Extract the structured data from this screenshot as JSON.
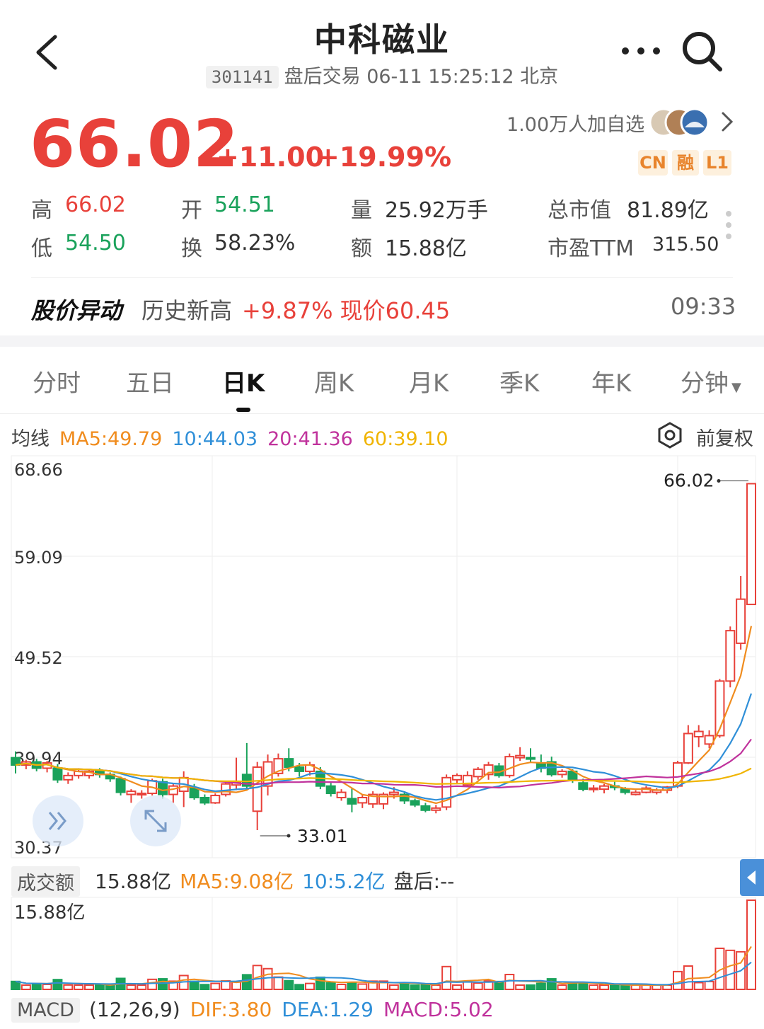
{
  "header": {
    "title": "中科磁业",
    "code": "301141",
    "status": "盘后交易 06-11 15:25:12 北京",
    "icons": [
      "back-icon",
      "more-icon",
      "search-icon"
    ]
  },
  "quote": {
    "price": "66.02",
    "change": "+11.00",
    "change_pct": "+19.99%",
    "watchers": "1.00万人加自选",
    "tags": [
      "CN",
      "融",
      "L1"
    ],
    "colors": {
      "up": "#e8413a",
      "down": "#1aa25b"
    }
  },
  "stats": {
    "high_label": "高",
    "high": "66.02",
    "open_label": "开",
    "open": "54.51",
    "volume_label": "量",
    "volume": "25.92万手",
    "mcap_label": "总市值",
    "mcap": "81.89亿",
    "low_label": "低",
    "low": "54.50",
    "turnover_label": "换",
    "turnover": "58.23%",
    "amount_label": "额",
    "amount": "15.88亿",
    "pe_label": "市盈TTM",
    "pe": "315.50"
  },
  "alert": {
    "title": "股价异动",
    "text": "历史新高",
    "change": "+9.87% 现价60.45",
    "time": "09:33"
  },
  "tabs": [
    "分时",
    "五日",
    "日K",
    "周K",
    "月K",
    "季K",
    "年K",
    "分钟"
  ],
  "active_tab": "日K",
  "ma": {
    "label": "均线",
    "ma5": "MA5:49.79",
    "ma10": "10:44.03",
    "ma20": "20:41.36",
    "ma60": "60:39.10",
    "adjust": "前复权",
    "colors": {
      "ma5": "#f08c1e",
      "ma10": "#2f8fd8",
      "ma20": "#c0329c",
      "ma60": "#f0b400"
    }
  },
  "chart_data": {
    "type": "candlestick",
    "y_ticks": [
      "68.66",
      "59.09",
      "49.52",
      "39.94",
      "30.37"
    ],
    "ylim": [
      30.37,
      68.66
    ],
    "max_label": "66.02",
    "min_label": "33.01",
    "candles": [
      [
        39.9,
        40.5,
        38.4,
        39.2
      ],
      [
        39.2,
        39.7,
        38.8,
        39.5
      ],
      [
        39.5,
        39.8,
        38.6,
        38.9
      ],
      [
        38.9,
        39.6,
        38.5,
        39.4
      ],
      [
        38.9,
        39.3,
        37.5,
        37.8
      ],
      [
        37.8,
        38.5,
        37.4,
        38.2
      ],
      [
        38.2,
        38.9,
        37.9,
        38.6
      ],
      [
        38.2,
        38.8,
        37.9,
        38.6
      ],
      [
        38.6,
        38.9,
        38.0,
        38.3
      ],
      [
        38.3,
        38.5,
        37.6,
        37.9
      ],
      [
        37.9,
        38.1,
        36.3,
        36.6
      ],
      [
        36.4,
        36.9,
        35.6,
        36.7
      ],
      [
        36.4,
        36.8,
        36.0,
        36.5
      ],
      [
        36.5,
        37.9,
        36.3,
        37.7
      ],
      [
        37.6,
        37.9,
        36.0,
        36.4
      ],
      [
        36.4,
        37.5,
        35.6,
        37.2
      ],
      [
        36.7,
        38.6,
        35.2,
        38.0
      ],
      [
        37.0,
        37.4,
        35.9,
        36.1
      ],
      [
        36.1,
        36.4,
        35.4,
        35.6
      ],
      [
        35.6,
        36.5,
        35.5,
        36.3
      ],
      [
        36.4,
        37.6,
        36.2,
        37.4
      ],
      [
        37.3,
        39.9,
        36.8,
        37.6
      ],
      [
        38.3,
        41.3,
        36.8,
        37.2
      ],
      [
        34.8,
        39.5,
        33.0,
        39.0
      ],
      [
        37.2,
        40.2,
        36.3,
        39.5
      ],
      [
        38.4,
        40.3,
        38.1,
        39.8
      ],
      [
        39.8,
        40.8,
        38.6,
        39.0
      ],
      [
        39.0,
        39.4,
        38.1,
        38.6
      ],
      [
        38.6,
        39.5,
        38.2,
        39.2
      ],
      [
        38.6,
        39.0,
        36.9,
        37.2
      ],
      [
        37.2,
        37.5,
        36.2,
        36.5
      ],
      [
        36.1,
        36.9,
        35.8,
        36.6
      ],
      [
        36.0,
        37.0,
        34.7,
        35.5
      ],
      [
        35.6,
        36.4,
        35.1,
        36.1
      ],
      [
        35.5,
        36.7,
        35.1,
        36.4
      ],
      [
        35.5,
        36.6,
        35.0,
        36.4
      ],
      [
        36.4,
        37.1,
        36.0,
        36.6
      ],
      [
        36.4,
        36.7,
        35.5,
        35.8
      ],
      [
        35.8,
        36.0,
        35.2,
        35.4
      ],
      [
        35.3,
        35.6,
        34.7,
        34.9
      ],
      [
        34.9,
        35.4,
        34.6,
        35.1
      ],
      [
        35.2,
        38.3,
        34.9,
        38.0
      ],
      [
        37.8,
        38.4,
        37.5,
        38.2
      ],
      [
        37.3,
        38.6,
        37.1,
        38.2
      ],
      [
        38.1,
        39.0,
        37.8,
        38.8
      ],
      [
        38.3,
        39.5,
        37.8,
        39.2
      ],
      [
        39.1,
        39.4,
        38.0,
        38.2
      ],
      [
        38.2,
        40.3,
        38.0,
        40.0
      ],
      [
        39.9,
        40.9,
        39.6,
        40.1
      ],
      [
        39.9,
        40.8,
        39.5,
        39.8
      ],
      [
        39.4,
        40.2,
        38.5,
        38.9
      ],
      [
        39.5,
        40.0,
        38.1,
        38.3
      ],
      [
        38.3,
        38.8,
        38.0,
        38.6
      ],
      [
        38.6,
        38.8,
        37.5,
        37.8
      ],
      [
        37.5,
        37.9,
        36.7,
        36.9
      ],
      [
        36.9,
        37.3,
        36.6,
        37.0
      ],
      [
        36.9,
        37.4,
        36.5,
        37.2
      ],
      [
        37.2,
        37.6,
        36.8,
        37.1
      ],
      [
        36.9,
        37.1,
        36.4,
        36.6
      ],
      [
        36.4,
        36.8,
        36.3,
        36.6
      ],
      [
        36.6,
        37.2,
        36.5,
        37.0
      ],
      [
        36.6,
        37.0,
        36.4,
        36.8
      ],
      [
        36.8,
        37.2,
        36.5,
        37.1
      ],
      [
        37.2,
        39.6,
        37.0,
        39.4
      ],
      [
        39.4,
        43.0,
        39.3,
        42.2
      ],
      [
        41.9,
        43.0,
        40.9,
        42.4
      ],
      [
        41.2,
        42.5,
        40.8,
        42.0
      ],
      [
        42.0,
        47.4,
        41.8,
        47.2
      ],
      [
        47.2,
        52.4,
        46.6,
        52.0
      ],
      [
        50.8,
        57.2,
        50.2,
        55.0
      ],
      [
        54.5,
        66.0,
        54.5,
        66.0
      ]
    ],
    "ma5_colors": "orange/blue/purple/yellow"
  },
  "volume": {
    "label": "成交额",
    "value": "15.88亿",
    "ma5": "MA5:9.08亿",
    "ma10": "10:5.2亿",
    "after_hours": "盘后:--",
    "axis_max": "15.88亿"
  },
  "macd": {
    "label": "MACD",
    "params": "(12,26,9)",
    "dif": "DIF:3.80",
    "dea": "DEA:1.29",
    "macd": "MACD:5.02",
    "colors": {
      "dif": "#f08c1e",
      "dea": "#2f8fd8",
      "macd": "#c0329c"
    }
  }
}
